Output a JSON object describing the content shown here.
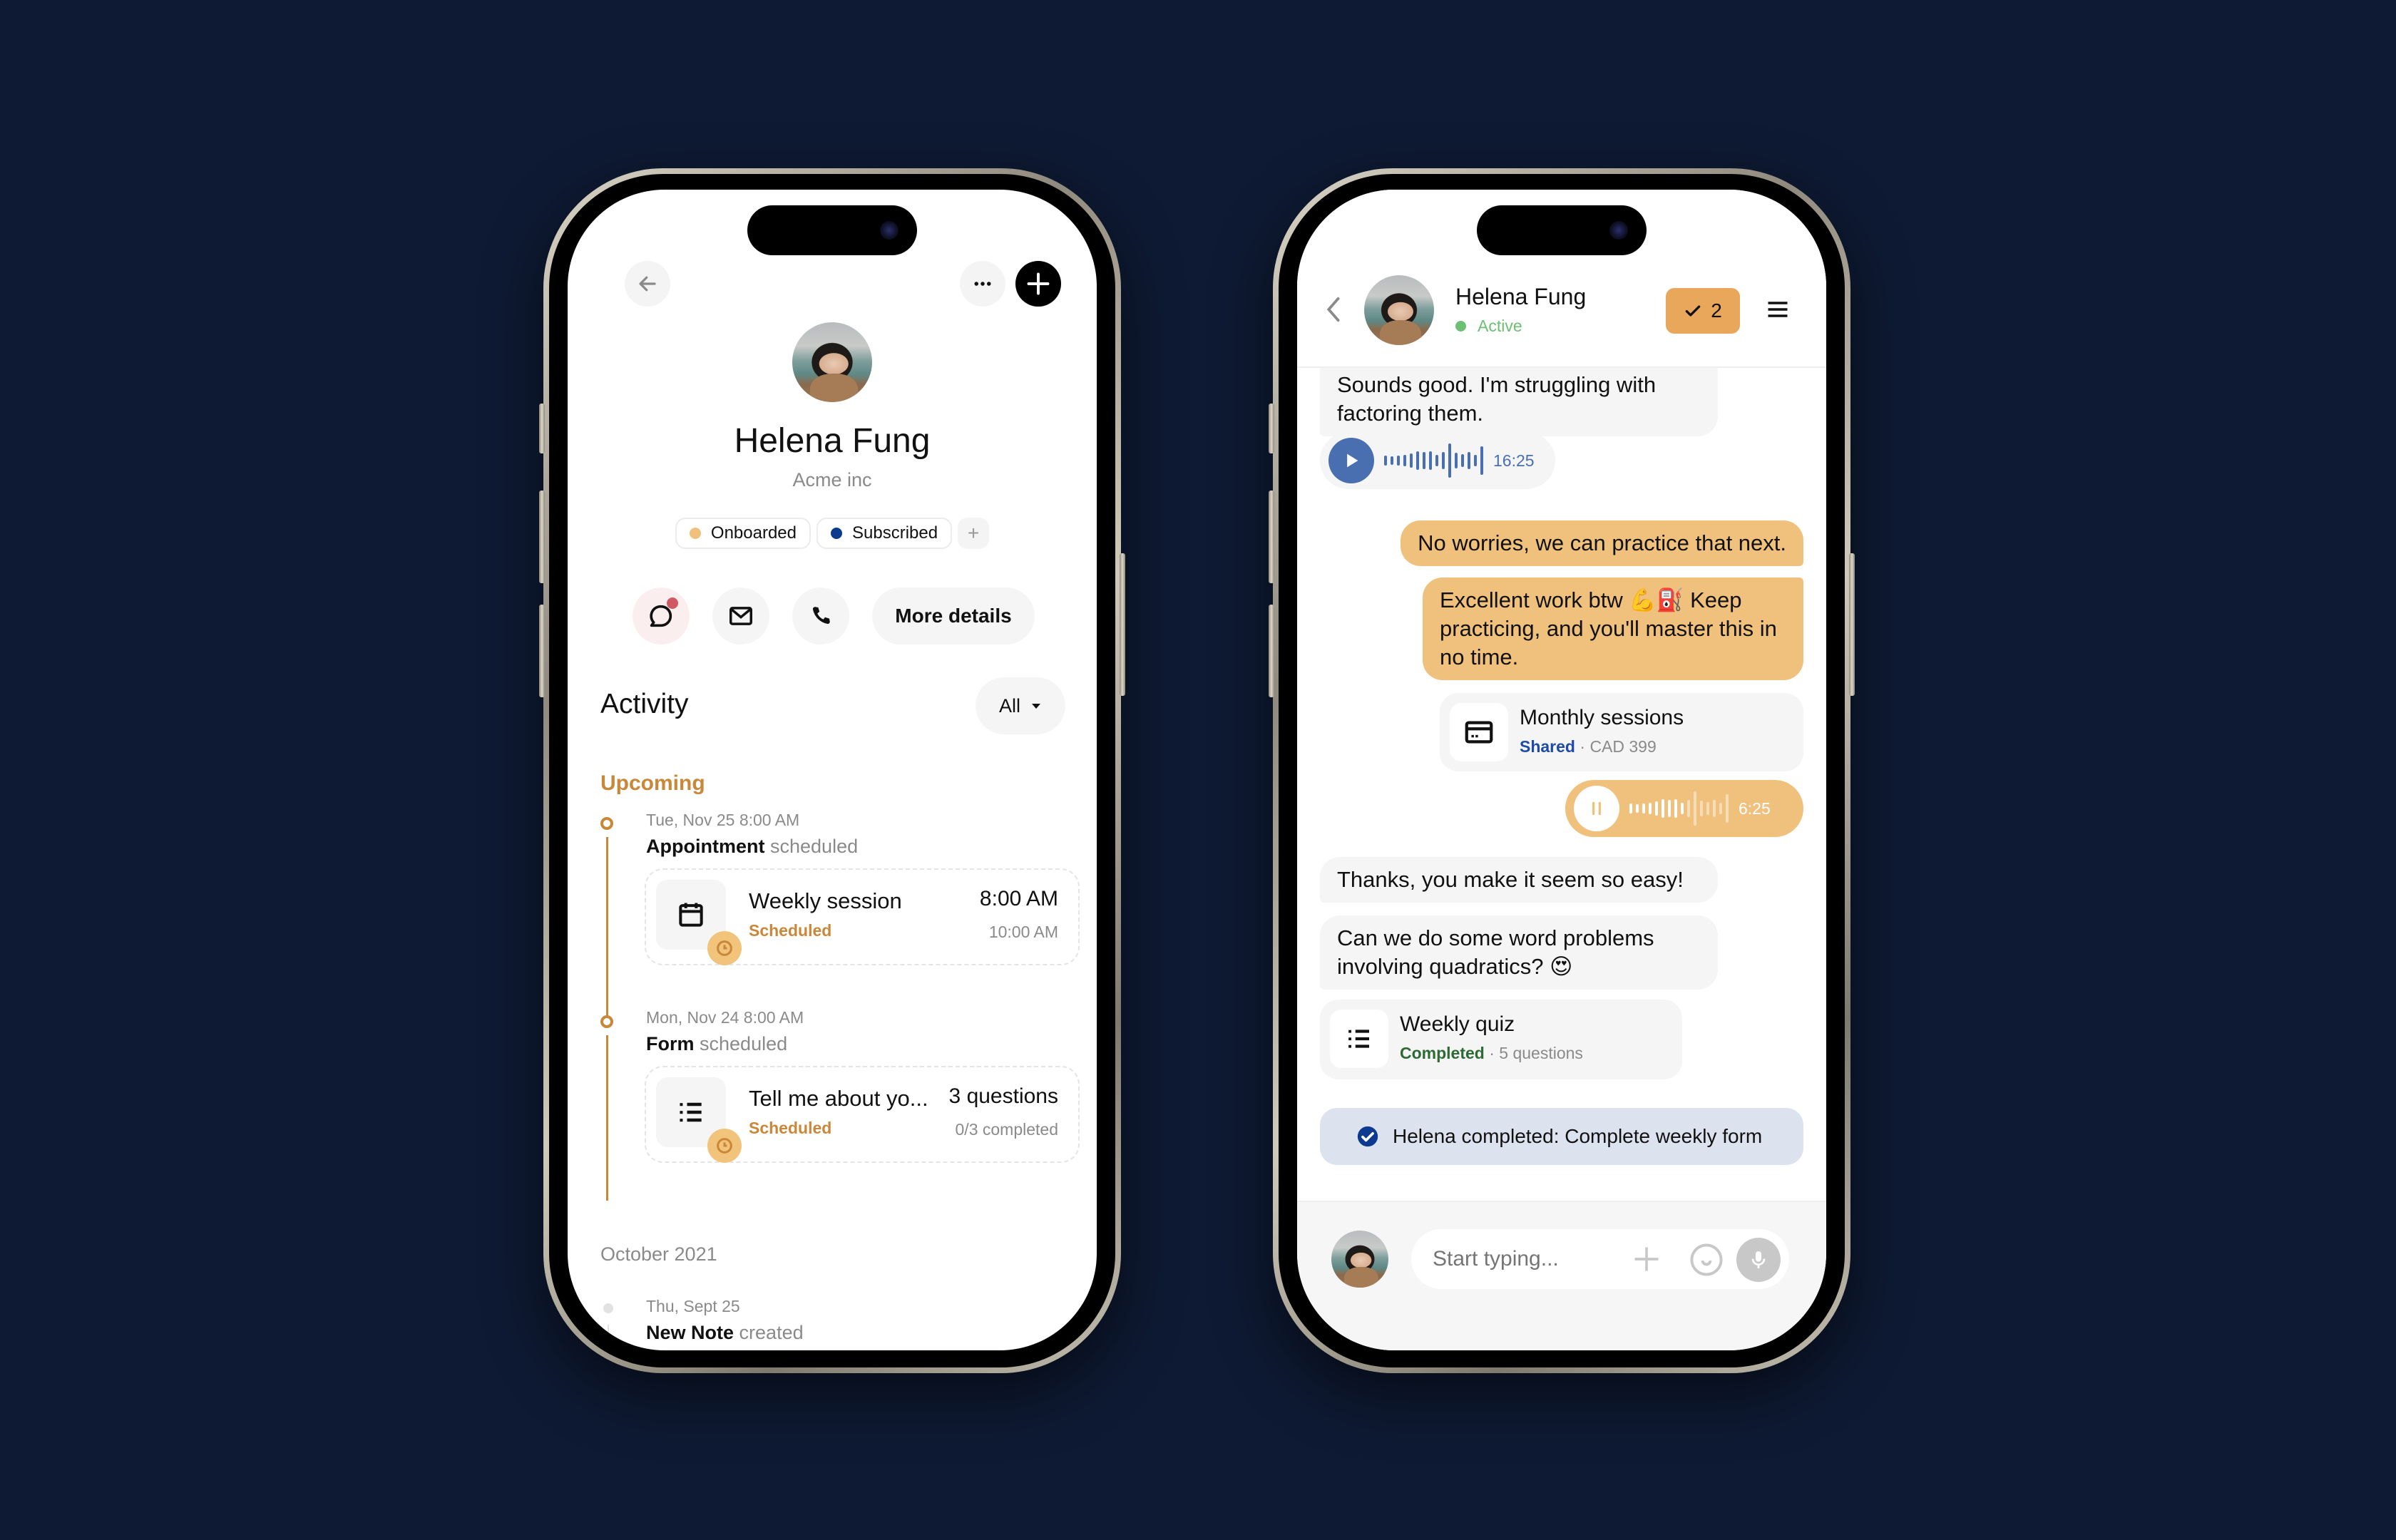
{
  "profile_screen": {
    "header": {
      "back_icon": "arrow-left-icon",
      "more_icon": "ellipsis-icon",
      "add_icon": "plus-icon"
    },
    "contact": {
      "name": "Helena Fung",
      "company": "Acme inc"
    },
    "tags": [
      {
        "label": "Onboarded",
        "color": "#efc17c"
      },
      {
        "label": "Subscribed",
        "color": "#0b3a8f"
      }
    ],
    "add_tag_label": "+",
    "actions": {
      "chat_icon": "chat-bubble-icon",
      "email_icon": "mail-icon",
      "phone_icon": "phone-icon",
      "more_details_label": "More details"
    },
    "activity": {
      "title": "Activity",
      "filter_label": "All",
      "upcoming_label": "Upcoming",
      "items": [
        {
          "timestamp": "Tue, Nov 25 8:00 AM",
          "type": "Appointment",
          "action": "scheduled",
          "card": {
            "icon": "calendar-icon",
            "title": "Weekly session",
            "status": "Scheduled",
            "right_primary": "8:00 AM",
            "right_secondary": "10:00 AM"
          }
        },
        {
          "timestamp": "Mon, Nov 24 8:00 AM",
          "type": "Form",
          "action": "scheduled",
          "card": {
            "icon": "list-icon",
            "title": "Tell me about yo...",
            "status": "Scheduled",
            "right_primary": "3 questions",
            "right_secondary": "0/3 completed"
          }
        }
      ],
      "past_section_label": "October 2021",
      "past_items": [
        {
          "timestamp": "Thu, Sept 25",
          "type": "New Note",
          "action": "created"
        }
      ]
    }
  },
  "chat_screen": {
    "header": {
      "back_icon": "chevron-left-icon",
      "name": "Helena Fung",
      "status": "Active",
      "status_color": "#6cbf73",
      "task_count": "2",
      "menu_icon": "hamburger-menu-icon"
    },
    "messages": [
      {
        "direction": "in",
        "text": "Sounds good. I'm struggling with factoring them."
      },
      {
        "direction": "in",
        "type": "audio",
        "duration": "16:25",
        "state": "paused"
      },
      {
        "direction": "out",
        "text": "No worries, we can practice that next."
      },
      {
        "direction": "out",
        "text": "Excellent work btw 💪⛽  Keep practicing, and you'll master this in no time."
      },
      {
        "direction": "out",
        "type": "shared-item",
        "title": "Monthly sessions",
        "status": "Shared",
        "detail": "CAD 399"
      },
      {
        "direction": "out",
        "type": "audio",
        "duration": "6:25",
        "state": "playing",
        "progress": 0.55
      },
      {
        "direction": "in",
        "text": "Thanks, you make it seem so easy!"
      },
      {
        "direction": "in",
        "text": "Can we do some word problems involving quadratics? 😍"
      },
      {
        "direction": "in",
        "type": "form",
        "title": "Weekly quiz",
        "status": "Completed",
        "detail": "5 questions"
      }
    ],
    "system_message": "Helena completed: Complete weekly form",
    "composer": {
      "placeholder": "Start typing...",
      "add_icon": "plus-icon",
      "emoji_icon": "smiley-icon",
      "mic_icon": "microphone-icon"
    }
  },
  "colors": {
    "background": "#0e1a33",
    "accent_orange": "#c98739",
    "outgoing_bubble": "#f0c17d",
    "audio_blue": "#4a6fb0",
    "shared_blue": "#1e4aa8",
    "completed_green": "#2e6b34",
    "system_bg": "#dde3ee",
    "notification_red": "#d05a64"
  }
}
